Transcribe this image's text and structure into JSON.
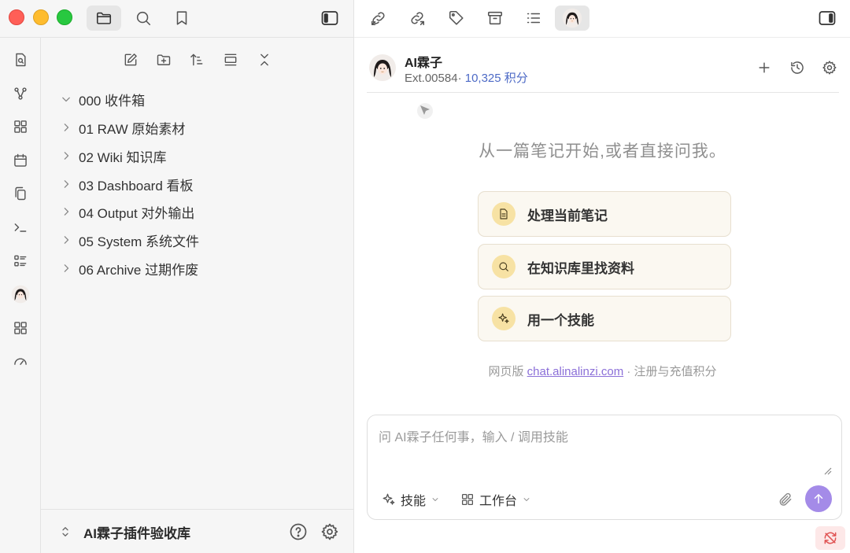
{
  "window": {
    "traffic_lights": {
      "close": "#ff5f57",
      "minimize": "#febc2e",
      "zoom": "#28c840"
    }
  },
  "titlebar": {
    "left_buttons": [
      "folder-icon",
      "search-icon",
      "bookmark-icon"
    ],
    "sidebar_toggle_left": "sidebar-left-icon",
    "right_buttons": [
      "backlinks-icon",
      "outgoing-links-icon",
      "tags-icon",
      "archive-icon",
      "outline-icon",
      "ai-avatar-icon"
    ],
    "sidebar_toggle_right": "sidebar-right-icon"
  },
  "ribbon": {
    "items": [
      "search-note-icon",
      "graph-icon",
      "canvas-icon",
      "calendar-icon",
      "copy-icon",
      "terminal-icon",
      "list-icon",
      "ai-avatar-icon",
      "grid-icon",
      "gauge-icon"
    ]
  },
  "explorer": {
    "toolbar": [
      "new-note-icon",
      "new-folder-icon",
      "sort-icon",
      "collapse-view-icon",
      "collapse-all-icon"
    ],
    "folders": [
      {
        "label": "000 收件箱",
        "expanded": true
      },
      {
        "label": "01 RAW 原始素材",
        "expanded": false
      },
      {
        "label": "02 Wiki 知识库",
        "expanded": false
      },
      {
        "label": "03 Dashboard 看板",
        "expanded": false
      },
      {
        "label": "04 Output 对外输出",
        "expanded": false
      },
      {
        "label": "05 System 系统文件",
        "expanded": false
      },
      {
        "label": "06 Archive 过期作废",
        "expanded": false
      }
    ],
    "vault_name": "AI霖子插件验收库"
  },
  "chat": {
    "bot_name": "AI霖子",
    "ext_id": "Ext.00584",
    "separator": "·",
    "points": "10,325 积分",
    "empty_title": "从一篇笔记开始,或者直接问我。",
    "actions": [
      {
        "label": "处理当前笔记",
        "icon": "document-icon"
      },
      {
        "label": "在知识库里找资料",
        "icon": "search-icon"
      },
      {
        "label": "用一个技能",
        "icon": "sparkle-icon"
      }
    ],
    "web_note_prefix": "网页版",
    "web_link": "chat.alinalinzi.com",
    "web_note_suffix": "· 注册与充值积分",
    "composer": {
      "placeholder": "问 AI霖子任何事，输入 / 调用技能",
      "skills_label": "技能",
      "workspace_label": "工作台"
    },
    "accent": "#a48be8"
  }
}
